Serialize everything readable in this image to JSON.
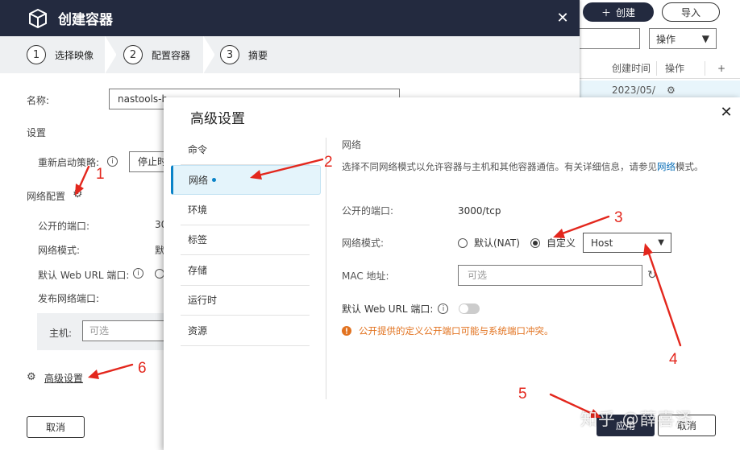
{
  "background_page": {
    "create_button": "创建",
    "import_button": "导入",
    "op_select": "操作",
    "table_headers": [
      "创建时间",
      "操作"
    ],
    "row_time": "2023/05/"
  },
  "create_dialog": {
    "title": "创建容器",
    "steps": [
      {
        "num": "1",
        "label": "选择映像"
      },
      {
        "num": "2",
        "label": "配置容器"
      },
      {
        "num": "3",
        "label": "摘要"
      }
    ],
    "name_label": "名称:",
    "name_value": "nastools-b",
    "settings_label": "设置",
    "restart_label": "重新启动策略:",
    "restart_value": "停止时",
    "network_config_label": "网络配置",
    "public_port_label": "公开的端口:",
    "public_port_value": "30",
    "network_mode_label": "网络模式:",
    "network_mode_value": "默",
    "web_url_label": "默认 Web URL 端口:",
    "publish_port_label": "发布网络端口:",
    "host_label": "主机:",
    "host_placeholder": "可选",
    "advanced_link": "高级设置",
    "cancel_button": "取消"
  },
  "advanced_dialog": {
    "title": "高级设置",
    "nav": [
      {
        "label": "命令",
        "active": false
      },
      {
        "label": "网络",
        "active": true
      },
      {
        "label": "环境",
        "active": false
      },
      {
        "label": "标签",
        "active": false
      },
      {
        "label": "存储",
        "active": false
      },
      {
        "label": "运行时",
        "active": false
      },
      {
        "label": "资源",
        "active": false
      }
    ],
    "section_heading": "网络",
    "description": "选择不同网络模式以允许容器与主机和其他容器通信。有关详细信息，请参见",
    "description_link": "网络",
    "description_suffix": "模式。",
    "public_port_label": "公开的端口:",
    "public_port_value": "3000/tcp",
    "network_mode_label": "网络模式:",
    "mode_default_label": "默认(NAT)",
    "mode_custom_label": "自定义",
    "mode_select_value": "Host",
    "mac_label": "MAC 地址:",
    "mac_placeholder": "可选",
    "web_url_label": "默认 Web URL 端口:",
    "warning_text": "公开提供的定义公开端口可能与系统端口冲突。",
    "apply_button": "应用",
    "cancel_button": "取消"
  },
  "annotations": [
    "1",
    "2",
    "3",
    "4",
    "5",
    "6"
  ],
  "watermark": "知乎 @薛喜泽",
  "colors": {
    "header_bg": "#232a3f",
    "accent": "#0a83c8",
    "annotation": "#e3271d",
    "warning": "#e27320"
  }
}
